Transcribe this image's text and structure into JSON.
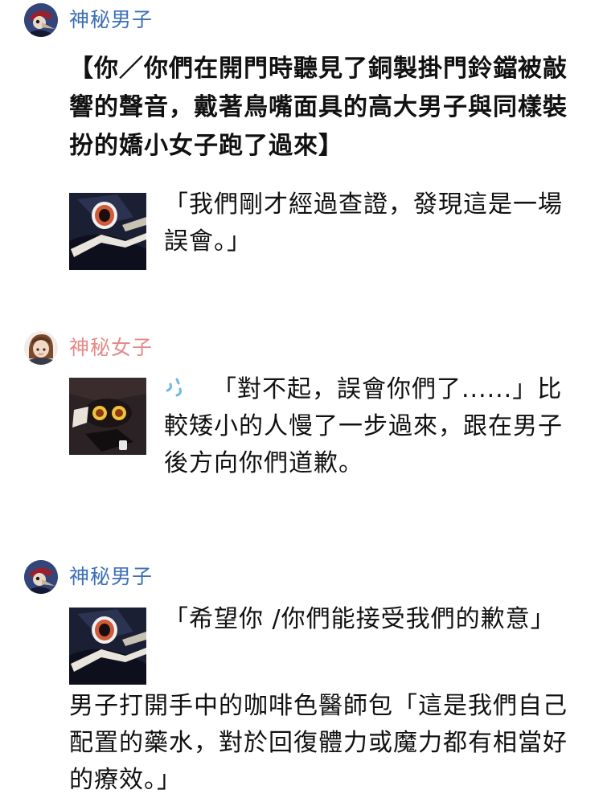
{
  "posts": [
    {
      "author": "神秘男子",
      "author_color": "#3b6fb6",
      "avatar": "beak-mask-man-avatar",
      "paragraphs": [
        "【你／你們在開門時聽見了銅製掛門鈴鐺被敲響的聲音，戴著鳥嘴面具的高大男子與同樣裝扮的嬌小女子跑了過來】",
        "「我們剛才經過查證，發現這是一場誤會。」"
      ]
    },
    {
      "author": "神秘女子",
      "author_color": "#e58a8a",
      "avatar": "brown-hair-woman-avatar",
      "paragraphs": [
        "「對不起，誤會你們了......」比較矮小的人慢了一步過來，跟在男子後方向你們道歉。"
      ]
    },
    {
      "author": "神秘男子",
      "author_color": "#3b6fb6",
      "avatar": "beak-mask-man-avatar",
      "paragraphs": [
        "「希望你 /你們能接受我們的歉意」",
        "男子打開手中的咖啡色醫師包「這是我們自己配置的藥水，對於回復體力或魔力都有相當好的療效。」"
      ]
    }
  ]
}
